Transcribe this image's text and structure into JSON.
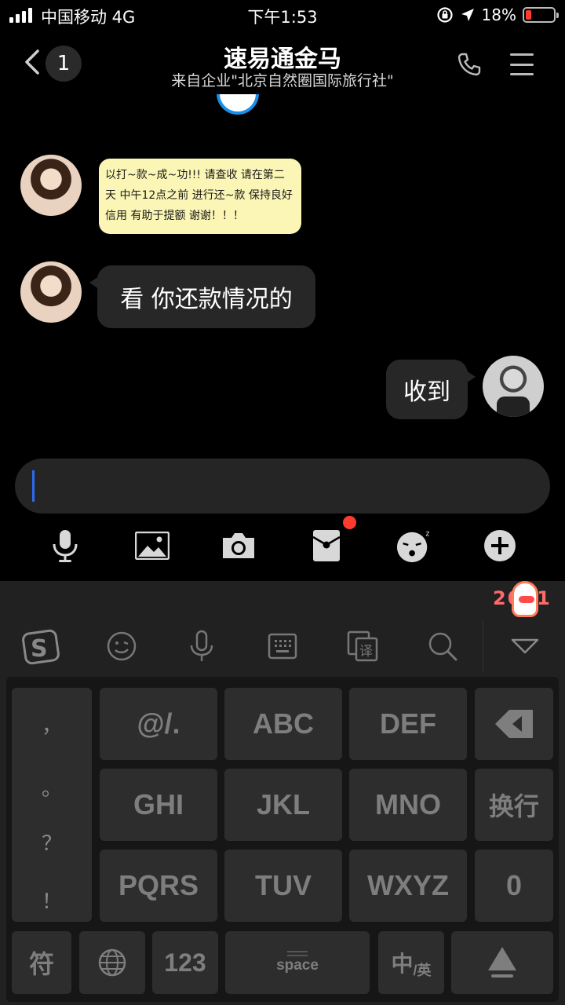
{
  "status_bar": {
    "carrier": "中国移动 4G",
    "time": "下午1:53",
    "battery": "18%",
    "battery_level": 0.18
  },
  "header": {
    "back_count": "1",
    "title": "速易通金马",
    "subtitle": "来自企业\"北京自然圈国际旅行社\""
  },
  "messages": {
    "sticker_text": "以打~款~成~功!!!  请查收  请在第二天  中午12点之前 进行还~款  保持良好信用  有助于提额 谢谢！！！",
    "left_text": "看 你还款情况的",
    "right_text": "收到"
  },
  "toolbar": {
    "icons": [
      "microphone-icon",
      "image-icon",
      "camera-icon",
      "red-packet-icon",
      "emoji-icon",
      "plus-icon"
    ]
  },
  "keyboard": {
    "badge": "2021",
    "punctuation": [
      "，",
      "。",
      "？",
      "！"
    ],
    "keys": {
      "k1": "@/.",
      "k2": "ABC",
      "k3": "DEF",
      "k4": "GHI",
      "k5": "JKL",
      "k6": "MNO",
      "newline": "换行",
      "k7": "PQRS",
      "k8": "TUV",
      "k9": "WXYZ",
      "zero": "0",
      "symbol": "符",
      "num": "123",
      "space": "space",
      "lang_main": "中",
      "lang_sub": "/英"
    }
  }
}
